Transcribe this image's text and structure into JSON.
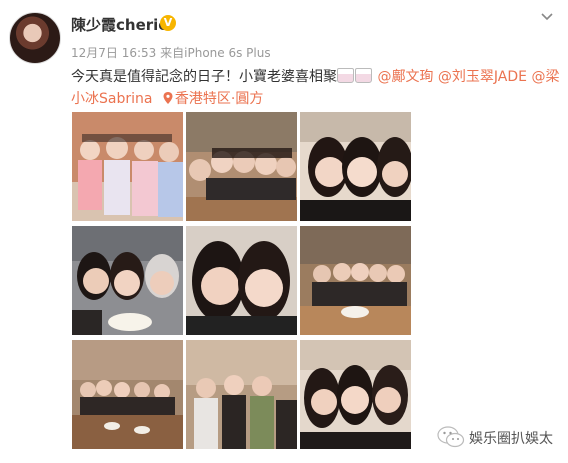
{
  "post": {
    "username": "陳少霞cherie",
    "verified_badge": "V",
    "timestamp": "12月7日 16:53",
    "source": "来自iPhone 6s Plus",
    "text_main": "今天真是值得記念的日子！小寶老婆喜相聚",
    "mentions": [
      "@鄺文珣",
      "@刘玉翠JADE",
      "@梁小冰Sabrina"
    ],
    "location": "香港特区·圓方"
  },
  "photos": [
    {
      "name": "photo-1",
      "scene": "costume"
    },
    {
      "name": "photo-2",
      "scene": "group"
    },
    {
      "name": "photo-3",
      "scene": "closeup"
    },
    {
      "name": "photo-4",
      "scene": "cake"
    },
    {
      "name": "photo-5",
      "scene": "selfie"
    },
    {
      "name": "photo-6",
      "scene": "dining"
    },
    {
      "name": "photo-7",
      "scene": "dining"
    },
    {
      "name": "photo-8",
      "scene": "group"
    },
    {
      "name": "photo-9",
      "scene": "kiss"
    }
  ],
  "watermark": {
    "text": "娛乐圈扒娛太"
  },
  "colors": {
    "link": "#eb7350",
    "meta": "#999999",
    "badge": "#f7b500"
  }
}
